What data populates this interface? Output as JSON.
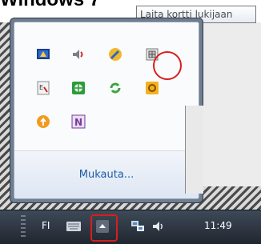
{
  "heading": "Windows 7",
  "tooltip": "Laita kortti lukijaan",
  "popup": {
    "customize_link": "Mukauta...",
    "icons": [
      {
        "name": "security-shield-icon"
      },
      {
        "name": "speaker-icon"
      },
      {
        "name": "key-pen-icon"
      },
      {
        "name": "smartcard-reader-icon"
      },
      {
        "name": "document-tool-icon"
      },
      {
        "name": "network-globe-icon"
      },
      {
        "name": "sync-arrows-icon"
      },
      {
        "name": "office-app-icon"
      },
      {
        "name": "update-arrow-icon"
      },
      {
        "name": "onenote-icon"
      }
    ]
  },
  "taskbar": {
    "language": "FI",
    "clock": "11:49",
    "icons": [
      "keyboard-icon",
      "show-hidden-icons-icon",
      "network-icon",
      "volume-icon"
    ]
  },
  "colors": {
    "highlight": "#d81e1e",
    "link": "#1e5aa5",
    "taskbar": "#2b333e"
  }
}
